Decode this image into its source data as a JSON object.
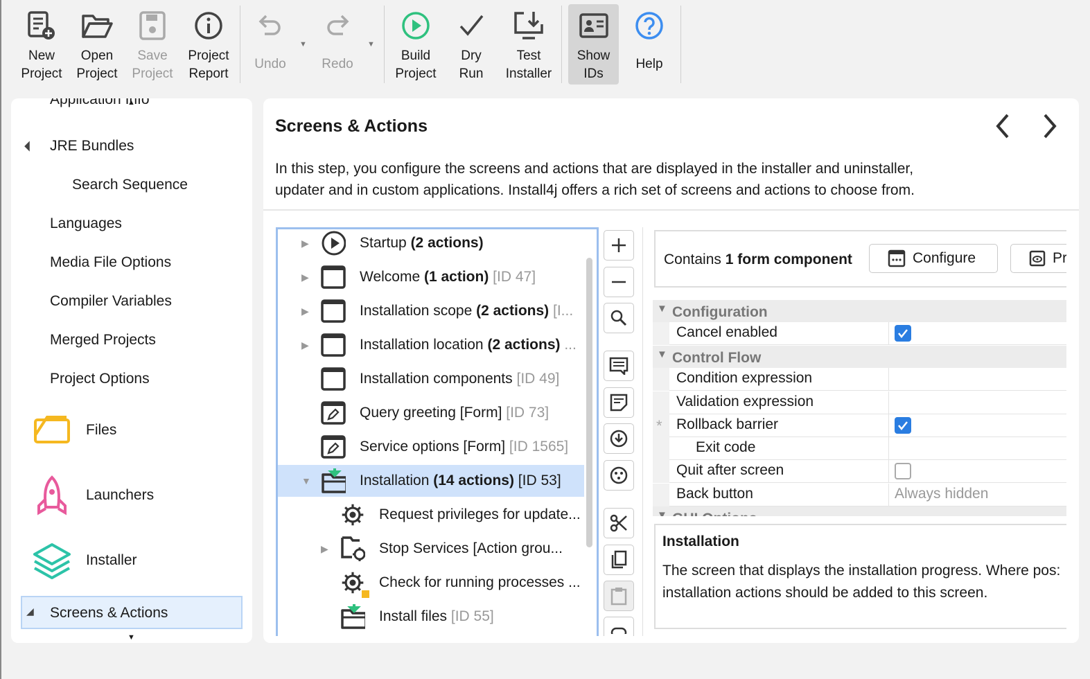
{
  "toolbar": {
    "items": [
      {
        "l1": "New",
        "l2": "Project",
        "icon": "new-project-icon",
        "enabled": true
      },
      {
        "l1": "Open",
        "l2": "Project",
        "icon": "open-folder-icon",
        "enabled": true
      },
      {
        "l1": "Save",
        "l2": "Project",
        "icon": "save-icon",
        "enabled": false
      },
      {
        "l1": "Project",
        "l2": "Report",
        "icon": "info-icon",
        "enabled": true
      },
      {
        "l1": "Undo",
        "icon": "undo-icon",
        "enabled": false
      },
      {
        "l1": "Redo",
        "icon": "redo-icon",
        "enabled": false
      },
      {
        "l1": "Build",
        "l2": "Project",
        "icon": "play-circle-icon",
        "enabled": true
      },
      {
        "l1": "Dry",
        "l2": "Run",
        "icon": "checkmark-icon",
        "enabled": true
      },
      {
        "l1": "Test",
        "l2": "Installer",
        "icon": "monitor-download-icon",
        "enabled": true
      },
      {
        "l1": "Show",
        "l2": "IDs",
        "icon": "id-card-icon",
        "enabled": true,
        "selected": true
      },
      {
        "l1": "Help",
        "icon": "help-icon",
        "enabled": true
      }
    ]
  },
  "sidebar": {
    "items": [
      {
        "label": "Application Info"
      },
      {
        "label": "JRE Bundles",
        "expanded": true
      },
      {
        "label": "Search Sequence"
      },
      {
        "label": "Languages"
      },
      {
        "label": "Media File Options"
      },
      {
        "label": "Compiler Variables"
      },
      {
        "label": "Merged Projects"
      },
      {
        "label": "Project Options"
      },
      {
        "label": "Files",
        "icon": "files-icon"
      },
      {
        "label": "Launchers",
        "icon": "rocket-icon"
      },
      {
        "label": "Installer",
        "icon": "layers-icon"
      },
      {
        "label": "Screens & Actions",
        "selected": true,
        "expanded": true
      }
    ]
  },
  "main": {
    "title": "Screens & Actions",
    "description1": "In this step, you configure the screens and actions that are displayed in the installer and uninstaller,",
    "description2": "updater and in custom applications. Install4j offers a rich set of screens and actions to choose from."
  },
  "tree": [
    {
      "name": "Startup",
      "bold": "(2 actions)",
      "id": "",
      "exp": "collapsed",
      "icon": "play-circle-icon",
      "level": 0
    },
    {
      "name": "Welcome",
      "bold": "(1 action)",
      "id": "[ID 47]",
      "exp": "collapsed",
      "icon": "window-icon",
      "level": 0
    },
    {
      "name": "Installation scope",
      "bold": "(2 actions)",
      "id": "[I...",
      "exp": "collapsed",
      "icon": "window-icon",
      "level": 0
    },
    {
      "name": "Installation location",
      "bold": "(2 actions)",
      "id": "...",
      "exp": "collapsed",
      "icon": "window-icon",
      "level": 0
    },
    {
      "name": "Installation components",
      "bold": "",
      "id": "[ID 49]",
      "exp": "",
      "icon": "window-icon",
      "level": 0
    },
    {
      "name": "Query greeting [Form]",
      "bold": "",
      "id": "[ID 73]",
      "exp": "",
      "icon": "form-icon",
      "level": 0
    },
    {
      "name": "Service options [Form]",
      "bold": "",
      "id": "[ID 1565]",
      "exp": "",
      "icon": "form-icon",
      "level": 0
    },
    {
      "name": "Installation",
      "bold": "(14 actions)",
      "id": "[ID 53]",
      "exp": "expanded",
      "icon": "install-folder-icon",
      "level": 0,
      "selected": true
    },
    {
      "name": "Request privileges for update...",
      "bold": "",
      "id": "",
      "exp": "",
      "icon": "gear-icon",
      "level": 1
    },
    {
      "name": "Stop Services [Action grou...",
      "bold": "",
      "id": "",
      "exp": "collapsed",
      "icon": "folder-gear-icon",
      "level": 1
    },
    {
      "name": "Check for running processes ...",
      "bold": "",
      "id": "",
      "exp": "",
      "icon": "gear-icon",
      "level": 1
    },
    {
      "name": "Install files",
      "bold": "",
      "id": "[ID 55]",
      "exp": "",
      "icon": "install-folder-icon",
      "level": 1
    }
  ],
  "form": {
    "prefix": "Contains",
    "bold": "1 form component",
    "configure": "Configure",
    "preview": "Pr"
  },
  "properties": {
    "sections": [
      "Configuration",
      "Control Flow",
      "GUI Options"
    ],
    "rows": [
      {
        "key": "Cancel enabled",
        "value": "checked"
      },
      {
        "key": "Condition expression",
        "value": ""
      },
      {
        "key": "Validation expression",
        "value": ""
      },
      {
        "key": "Rollback barrier",
        "value": "checked",
        "marker": "*"
      },
      {
        "key": "Exit code",
        "value": ""
      },
      {
        "key": "Quit after screen",
        "value": "unchecked"
      },
      {
        "key": "Back button",
        "value": "Always hidden"
      }
    ]
  },
  "info": {
    "title": "Installation",
    "line1": "The screen that displays the installation progress. Where pos:",
    "line2": "installation actions should be added to this screen."
  },
  "colors": {
    "accent": "#2a7de1",
    "selection": "#cfe2fb",
    "build": "#2fc17f",
    "help": "#3d8ef0"
  }
}
